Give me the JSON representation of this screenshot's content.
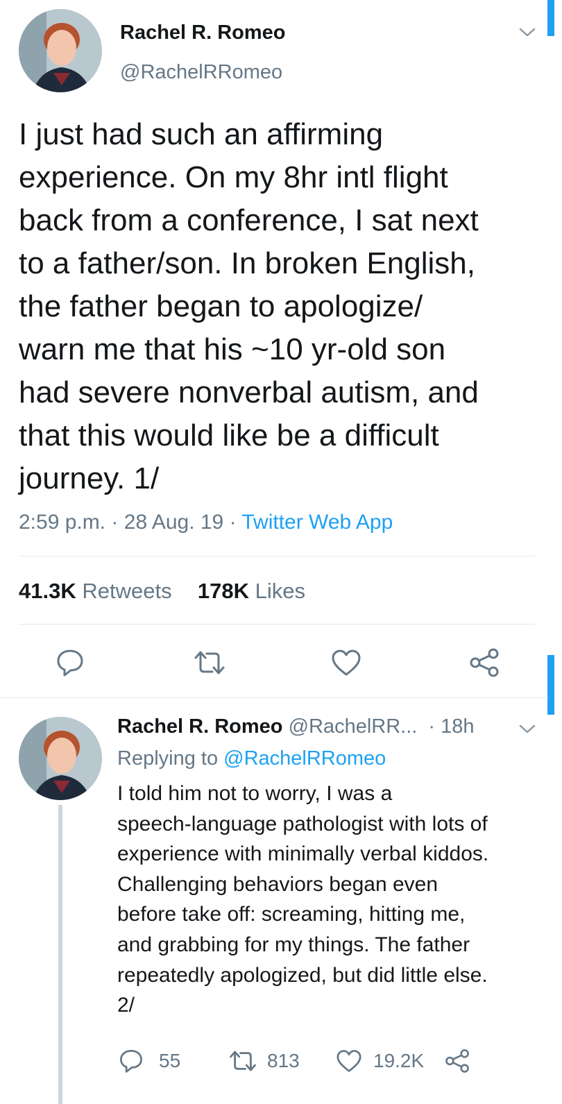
{
  "tweet": {
    "author_name": "Rachel R. Romeo",
    "author_handle": "@RachelRRomeo",
    "text": "I just had such an affirming\nexperience. On my 8hr intl flight\nback from a conference, I sat next\nto a father/son. In broken English,\nthe father began to apologize/\nwarn me that his ~10 yr-old son\nhad severe nonverbal autism, and\nthat this would like be a difficult\njourney. 1/",
    "time": "2:59 p.m.",
    "date": "28 Aug. 19",
    "sep": "·",
    "source": "Twitter Web App",
    "retweets_count": "41.3K",
    "retweets_label": "Retweets",
    "likes_count": "178K",
    "likes_label": "Likes"
  },
  "reply": {
    "author_name": "Rachel R. Romeo",
    "author_handle": "@RachelRR...",
    "age": "· 18h",
    "replying_label": "Replying to",
    "replying_handle": "@RachelRRomeo",
    "text": "I told him not to worry, I was a\nspeech-language pathologist with lots of\nexperience with minimally verbal kiddos.\nChallenging behaviors began even\nbefore take off: screaming, hitting me,\nand grabbing for my things. The father\nrepeatedly apologized, but did little else.\n2/",
    "reply_count": "55",
    "retweet_count": "813",
    "like_count": "19.2K"
  },
  "colors": {
    "accent": "#1da1f2",
    "secondary_text": "#657786",
    "primary_text": "#14171a",
    "divider": "#e1e8ed",
    "thread_line": "#ccd6dd"
  },
  "icons": [
    "chevron-down-icon",
    "reply-icon",
    "retweet-icon",
    "like-icon",
    "share-icon"
  ]
}
